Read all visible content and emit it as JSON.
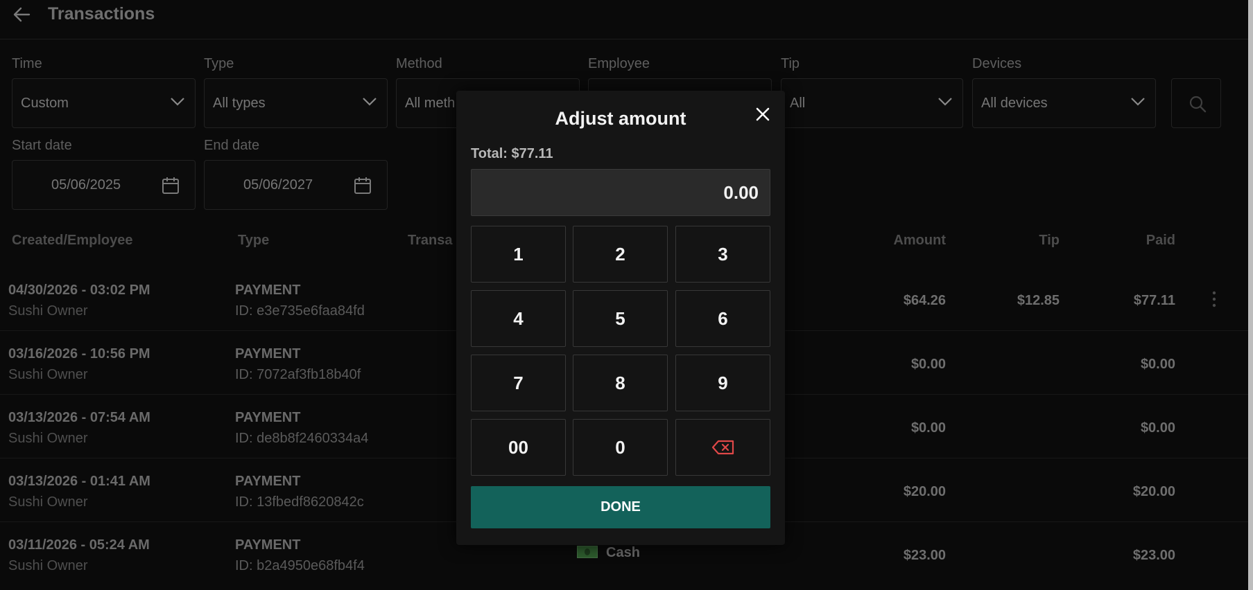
{
  "header": {
    "title": "Transactions"
  },
  "filters": {
    "time": {
      "label": "Time",
      "value": "Custom"
    },
    "type": {
      "label": "Type",
      "value": "All types"
    },
    "method": {
      "label": "Method",
      "value": "All meth"
    },
    "employee": {
      "label": "Employee"
    },
    "tip": {
      "label": "Tip",
      "value": "All"
    },
    "devices": {
      "label": "Devices",
      "value": "All devices"
    },
    "start_date": {
      "label": "Start date",
      "value": "05/06/2025"
    },
    "end_date": {
      "label": "End date",
      "value": "05/06/2027"
    }
  },
  "table": {
    "headers": {
      "created": "Created/Employee",
      "type": "Type",
      "transaction": "Transa",
      "amount": "Amount",
      "tip": "Tip",
      "paid": "Paid"
    },
    "rows": [
      {
        "date": "04/30/2026 - 03:02 PM",
        "employee": "Sushi Owner",
        "type": "PAYMENT",
        "id": "ID: e3e735e6faa84fd",
        "amount": "$64.26",
        "tip": "$12.85",
        "paid": "$77.11"
      },
      {
        "date": "03/16/2026 - 10:56 PM",
        "employee": "Sushi Owner",
        "type": "PAYMENT",
        "id": "ID: 7072af3fb18b40f",
        "amount": "$0.00",
        "tip": "",
        "paid": "$0.00"
      },
      {
        "date": "03/13/2026 - 07:54 AM",
        "employee": "Sushi Owner",
        "type": "PAYMENT",
        "id": "ID: de8b8f2460334a4",
        "amount": "$0.00",
        "tip": "",
        "paid": "$0.00"
      },
      {
        "date": "03/13/2026 - 01:41 AM",
        "employee": "Sushi Owner",
        "type": "PAYMENT",
        "id": "ID: 13fbedf8620842c",
        "amount": "$20.00",
        "tip": "",
        "paid": "$20.00"
      },
      {
        "date": "03/11/2026 - 05:24 AM",
        "employee": "Sushi Owner",
        "type": "PAYMENT",
        "id": "ID: b2a4950e68fb4f4",
        "method": "Cash",
        "amount": "$23.00",
        "tip": "",
        "paid": "$23.00"
      }
    ]
  },
  "modal": {
    "title": "Adjust amount",
    "total": "Total: $77.11",
    "input_value": "0.00",
    "keys": [
      "1",
      "2",
      "3",
      "4",
      "5",
      "6",
      "7",
      "8",
      "9",
      "00",
      "0"
    ],
    "done_label": "DONE"
  },
  "colors": {
    "background": "#0a0a0a",
    "modal_bg": "#151515",
    "accent": "#13625a",
    "backspace": "#e04848"
  },
  "icons": [
    "back-arrow-icon",
    "chevron-down-icon",
    "calendar-icon",
    "search-icon",
    "close-icon",
    "backspace-icon",
    "more-vertical-icon",
    "cash-icon"
  ]
}
